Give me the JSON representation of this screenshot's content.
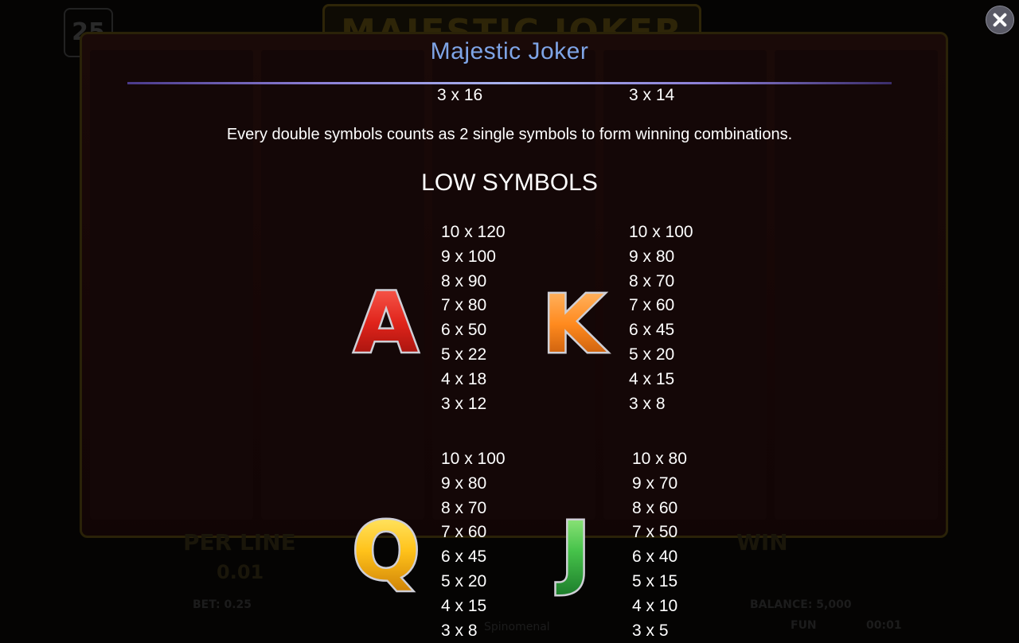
{
  "background": {
    "logo_text": "MAJESTIC JOKER",
    "lines_count": "25",
    "per_line_label": "PER LINE",
    "per_line_value": "0.01",
    "win_label": "WIN",
    "bet_text": "BET: 0.25",
    "balance_text": "BALANCE: 5,000",
    "fun_label": "FUN",
    "clock": "00:01",
    "brand": "Spinomenal"
  },
  "close_button": {
    "icon": "close-icon",
    "color": "#5a5a66"
  },
  "title": "Majestic Joker",
  "top_pays": {
    "left": "3 x 16",
    "right": "3 x 14"
  },
  "note": "Every double symbols counts as 2 single symbols to form winning combinations.",
  "section_title": "LOW SYMBOLS",
  "symbols": [
    {
      "letter": "A",
      "color": "#e0241b",
      "pays": [
        "10 x 120",
        "9 x 100",
        "8 x 90",
        "7 x 80",
        "6 x 50",
        "5 x 22",
        "4 x 18",
        "3 x 12"
      ]
    },
    {
      "letter": "K",
      "color": "#ff8a1e",
      "pays": [
        "10 x 100",
        "9 x 80",
        "8 x 70",
        "7 x 60",
        "6 x 45",
        "5 x 20",
        "4 x 15",
        "3 x 8"
      ]
    },
    {
      "letter": "Q",
      "color": "#ffc21a",
      "pays": [
        "10 x 100",
        "9 x 80",
        "8 x 70",
        "7 x 60",
        "6 x 45",
        "5 x 20",
        "4 x 15",
        "3 x 8"
      ]
    },
    {
      "letter": "J",
      "color": "#46c24a",
      "pays": [
        "10 x 80",
        "9 x 70",
        "8 x 60",
        "7 x 50",
        "6 x 40",
        "5 x 15",
        "4 x 10",
        "3 x 5"
      ]
    }
  ]
}
